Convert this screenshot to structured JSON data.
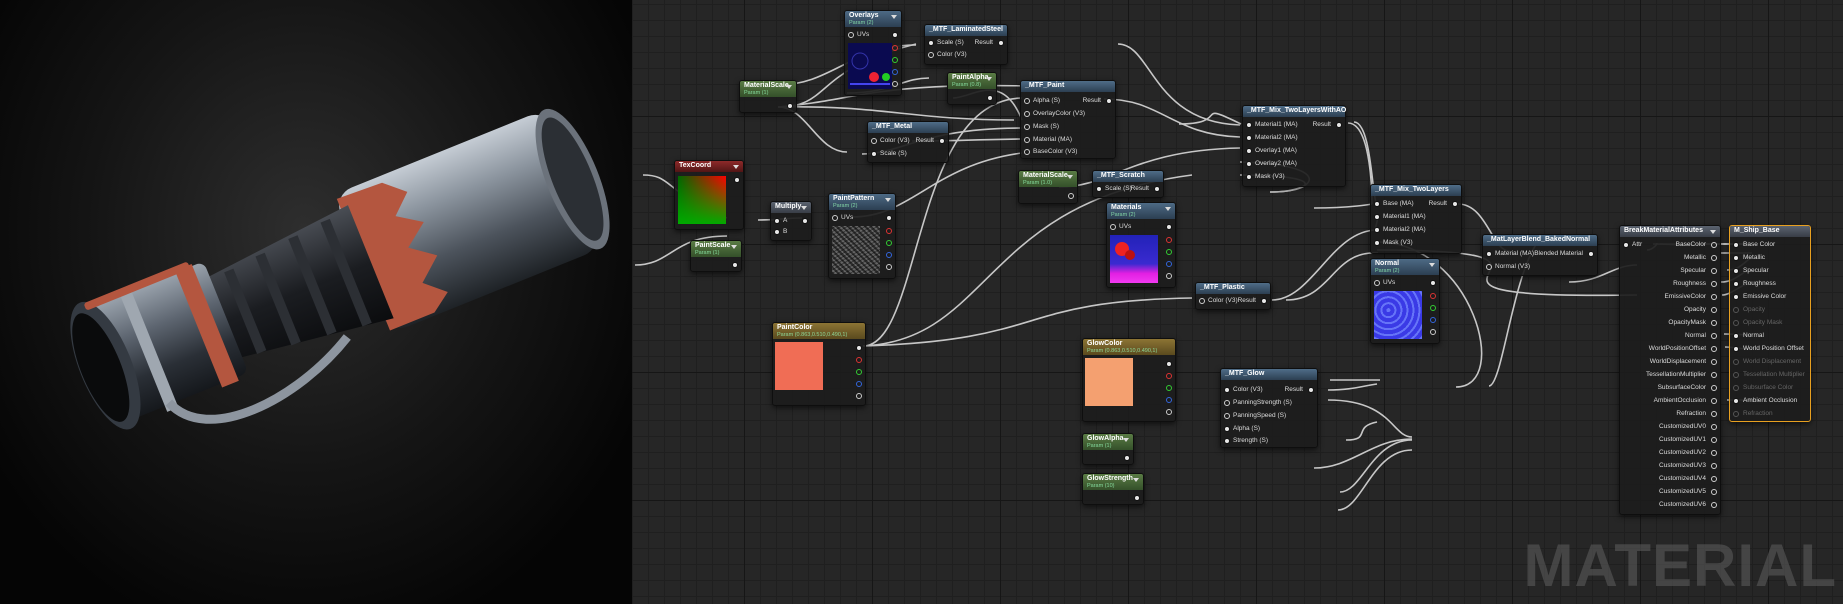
{
  "colors": {
    "wire": "#d9d9d9",
    "selection": "#e8a020",
    "paint_color": "#f06d55",
    "glow_color": "#f4a070"
  },
  "watermark": "MATERIAL",
  "nodes": {
    "overlays": {
      "title": "Overlays",
      "subtitle": "Param (2)",
      "pin": "UVs"
    },
    "laminated": {
      "title": "_MTF_LaminatedSteel",
      "pins": [
        "Scale (S)",
        "Color (V3)"
      ],
      "result": "Result"
    },
    "materialscale1": {
      "title": "MaterialScale",
      "subtitle": "Param (1)"
    },
    "paintalpha": {
      "title": "PaintAlpha",
      "subtitle": "Param (0.8)"
    },
    "mtf_paint": {
      "title": "_MTF_Paint",
      "pins": [
        "Alpha (S)",
        "OverlayColor (V3)",
        "Mask (S)",
        "Material (MA)",
        "BaseColor (V3)"
      ],
      "result": "Result"
    },
    "mtf_metal": {
      "title": "_MTF_Metal",
      "pins": [
        "Color (V3)",
        "Scale (S)"
      ],
      "result": "Result"
    },
    "mix_twolayers_ao": {
      "title": "_MTF_Mix_TwoLayersWithAO",
      "pins": [
        "Material1 (MA)",
        "Material2 (MA)",
        "Overlay1 (MA)",
        "Overlay2 (MA)",
        "Mask (V3)"
      ],
      "result": "Result"
    },
    "texcoord": {
      "title": "TexCoord"
    },
    "multiply": {
      "title": "Multiply",
      "pins": [
        "A",
        "B"
      ]
    },
    "paintpattern": {
      "title": "PaintPattern",
      "subtitle": "Param (2)",
      "pin": "UVs"
    },
    "materialscale2": {
      "title": "MaterialScale",
      "subtitle": "Param (1.0)"
    },
    "mtf_scratch": {
      "title": "_MTF_Scratch",
      "pins": [
        "Scale (S)"
      ],
      "result": "Result"
    },
    "materials": {
      "title": "Materials",
      "subtitle": "Param (2)",
      "pin": "UVs"
    },
    "paintscale": {
      "title": "PaintScale",
      "subtitle": "Param (1)"
    },
    "mix_twolayers": {
      "title": "_MTF_Mix_TwoLayers",
      "pins": [
        "Base (MA)",
        "Material1 (MA)",
        "Material2 (MA)",
        "Mask (V3)"
      ],
      "result": "Result"
    },
    "layerblend": {
      "title": "_MatLayerBlend_BakedNormal",
      "pins": [
        "Material (MA)",
        "Normal (V3)"
      ],
      "result": "Blended Material"
    },
    "breakattr": {
      "title": "BreakMaterialAttributes",
      "in": "Attr",
      "outs": [
        "BaseColor",
        "Metallic",
        "Specular",
        "Roughness",
        "EmissiveColor",
        "Opacity",
        "OpacityMask",
        "Normal",
        "WorldPositionOffset",
        "WorldDisplacement",
        "TessellationMultiplier",
        "SubsurfaceColor",
        "AmbientOcclusion",
        "Refraction",
        "CustomizedUV0",
        "CustomizedUV1",
        "CustomizedUV2",
        "CustomizedUV3",
        "CustomizedUV4",
        "CustomizedUV5",
        "CustomizedUV6"
      ]
    },
    "ship_base": {
      "title": "M_Ship_Base",
      "pins": [
        "Base Color",
        "Metallic",
        "Specular",
        "Roughness",
        "Emissive Color",
        "Opacity",
        "Opacity Mask",
        "Normal",
        "World Position Offset",
        "World Displacement",
        "Tessellation Multiplier",
        "Subsurface Color",
        "Ambient Occlusion",
        "Refraction"
      ],
      "active": [
        true,
        true,
        true,
        true,
        true,
        false,
        false,
        true,
        true,
        false,
        false,
        false,
        true,
        false
      ]
    },
    "normal": {
      "title": "Normal",
      "subtitle": "Param (2)",
      "pin": "UVs"
    },
    "mtf_plastic": {
      "title": "_MTF_Plastic",
      "pins": [
        "Color (V3)"
      ],
      "result": "Result"
    },
    "paintcolor": {
      "title": "PaintColor",
      "subtitle": "Param (0.863,0.510,0.490,1)"
    },
    "glowcolor": {
      "title": "GlowColor",
      "subtitle": "Param (0.863,0.510,0.490,1)"
    },
    "mtf_glow": {
      "title": "_MTF_Glow",
      "pins": [
        "Color (V3)",
        "PanningStrength (S)",
        "PanningSpeed (S)",
        "Alpha (S)",
        "Strength (S)"
      ],
      "result": "Result"
    },
    "glowalpha": {
      "title": "GlowAlpha",
      "subtitle": "Param (1)"
    },
    "glowstrength": {
      "title": "GlowStrength",
      "subtitle": "Param (10)"
    }
  }
}
